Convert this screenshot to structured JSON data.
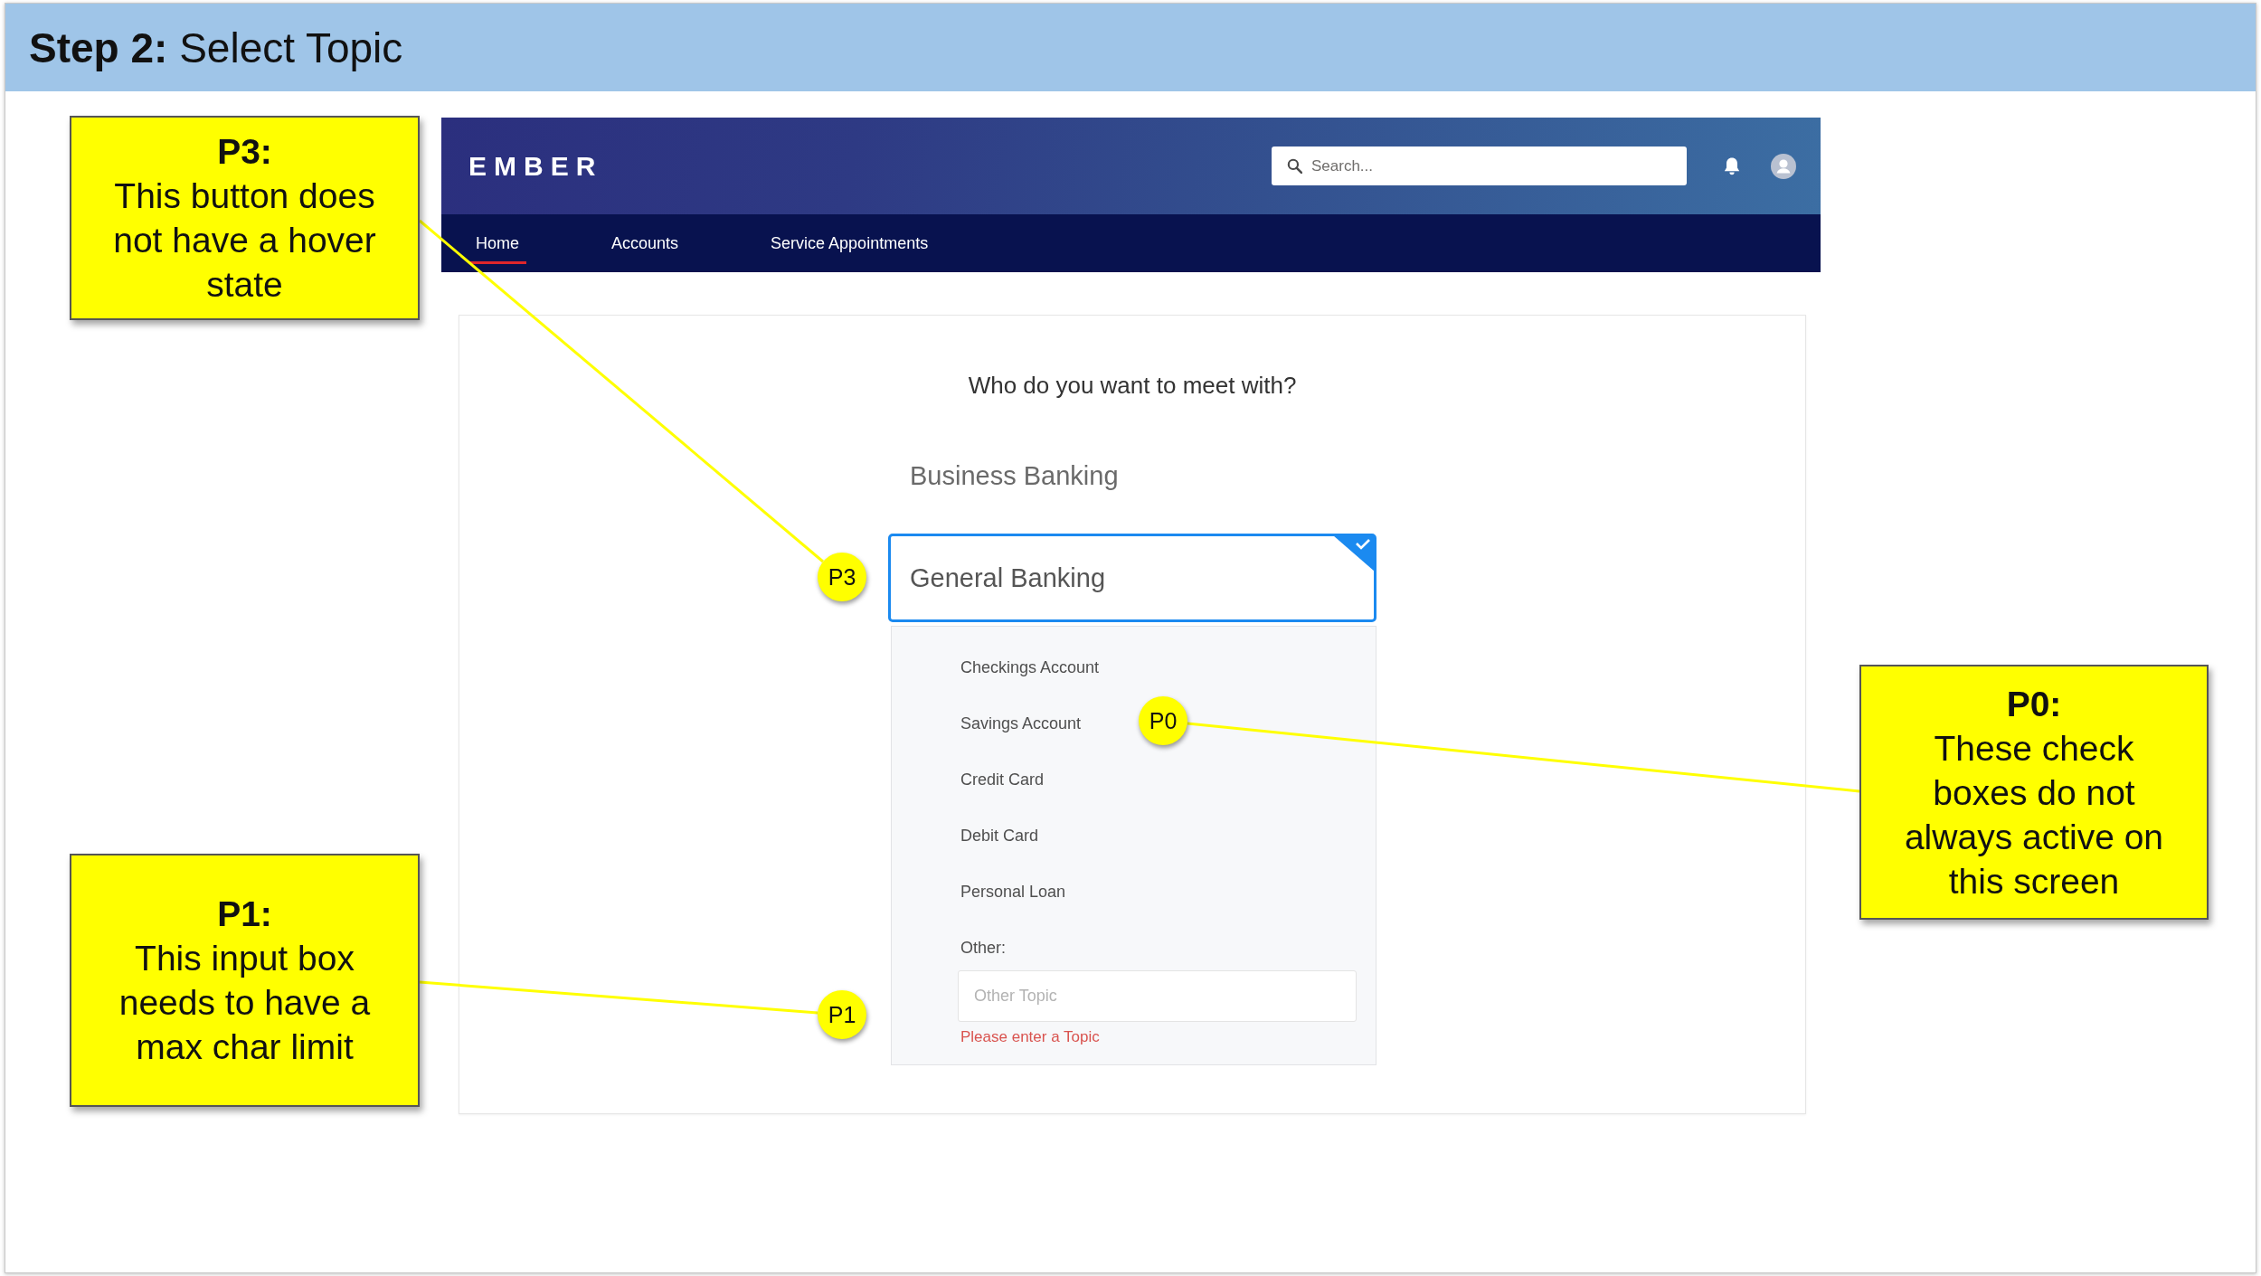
{
  "slide": {
    "title": "**Step 2:** Select Topic"
  },
  "app": {
    "logo": "EMBER",
    "search": {
      "placeholder": "Search..."
    },
    "nav": [
      {
        "label": "Home",
        "selected": true
      },
      {
        "label": "Accounts",
        "selected": false
      },
      {
        "label": "Service Appointments",
        "selected": false
      }
    ],
    "question": "Who do you want to meet with?",
    "options": [
      {
        "label": "Business Banking",
        "selected": false
      },
      {
        "label": "General Banking",
        "selected": true
      }
    ],
    "topics": [
      "Checkings Account",
      "Savings Account",
      "Credit Card",
      "Debit Card",
      "Personal Loan"
    ],
    "other": {
      "label": "Other:",
      "placeholder": "Other Topic",
      "error": "Please enter a Topic"
    }
  },
  "callouts": [
    {
      "marker": "P3",
      "heading": "P3:",
      "text": "This button does not have a hover state"
    },
    {
      "marker": "P0",
      "heading": "P0:",
      "text": "These check boxes do not always active on this screen"
    },
    {
      "marker": "P1",
      "heading": "P1:",
      "text": "This input box needs to have a max char limit"
    }
  ]
}
